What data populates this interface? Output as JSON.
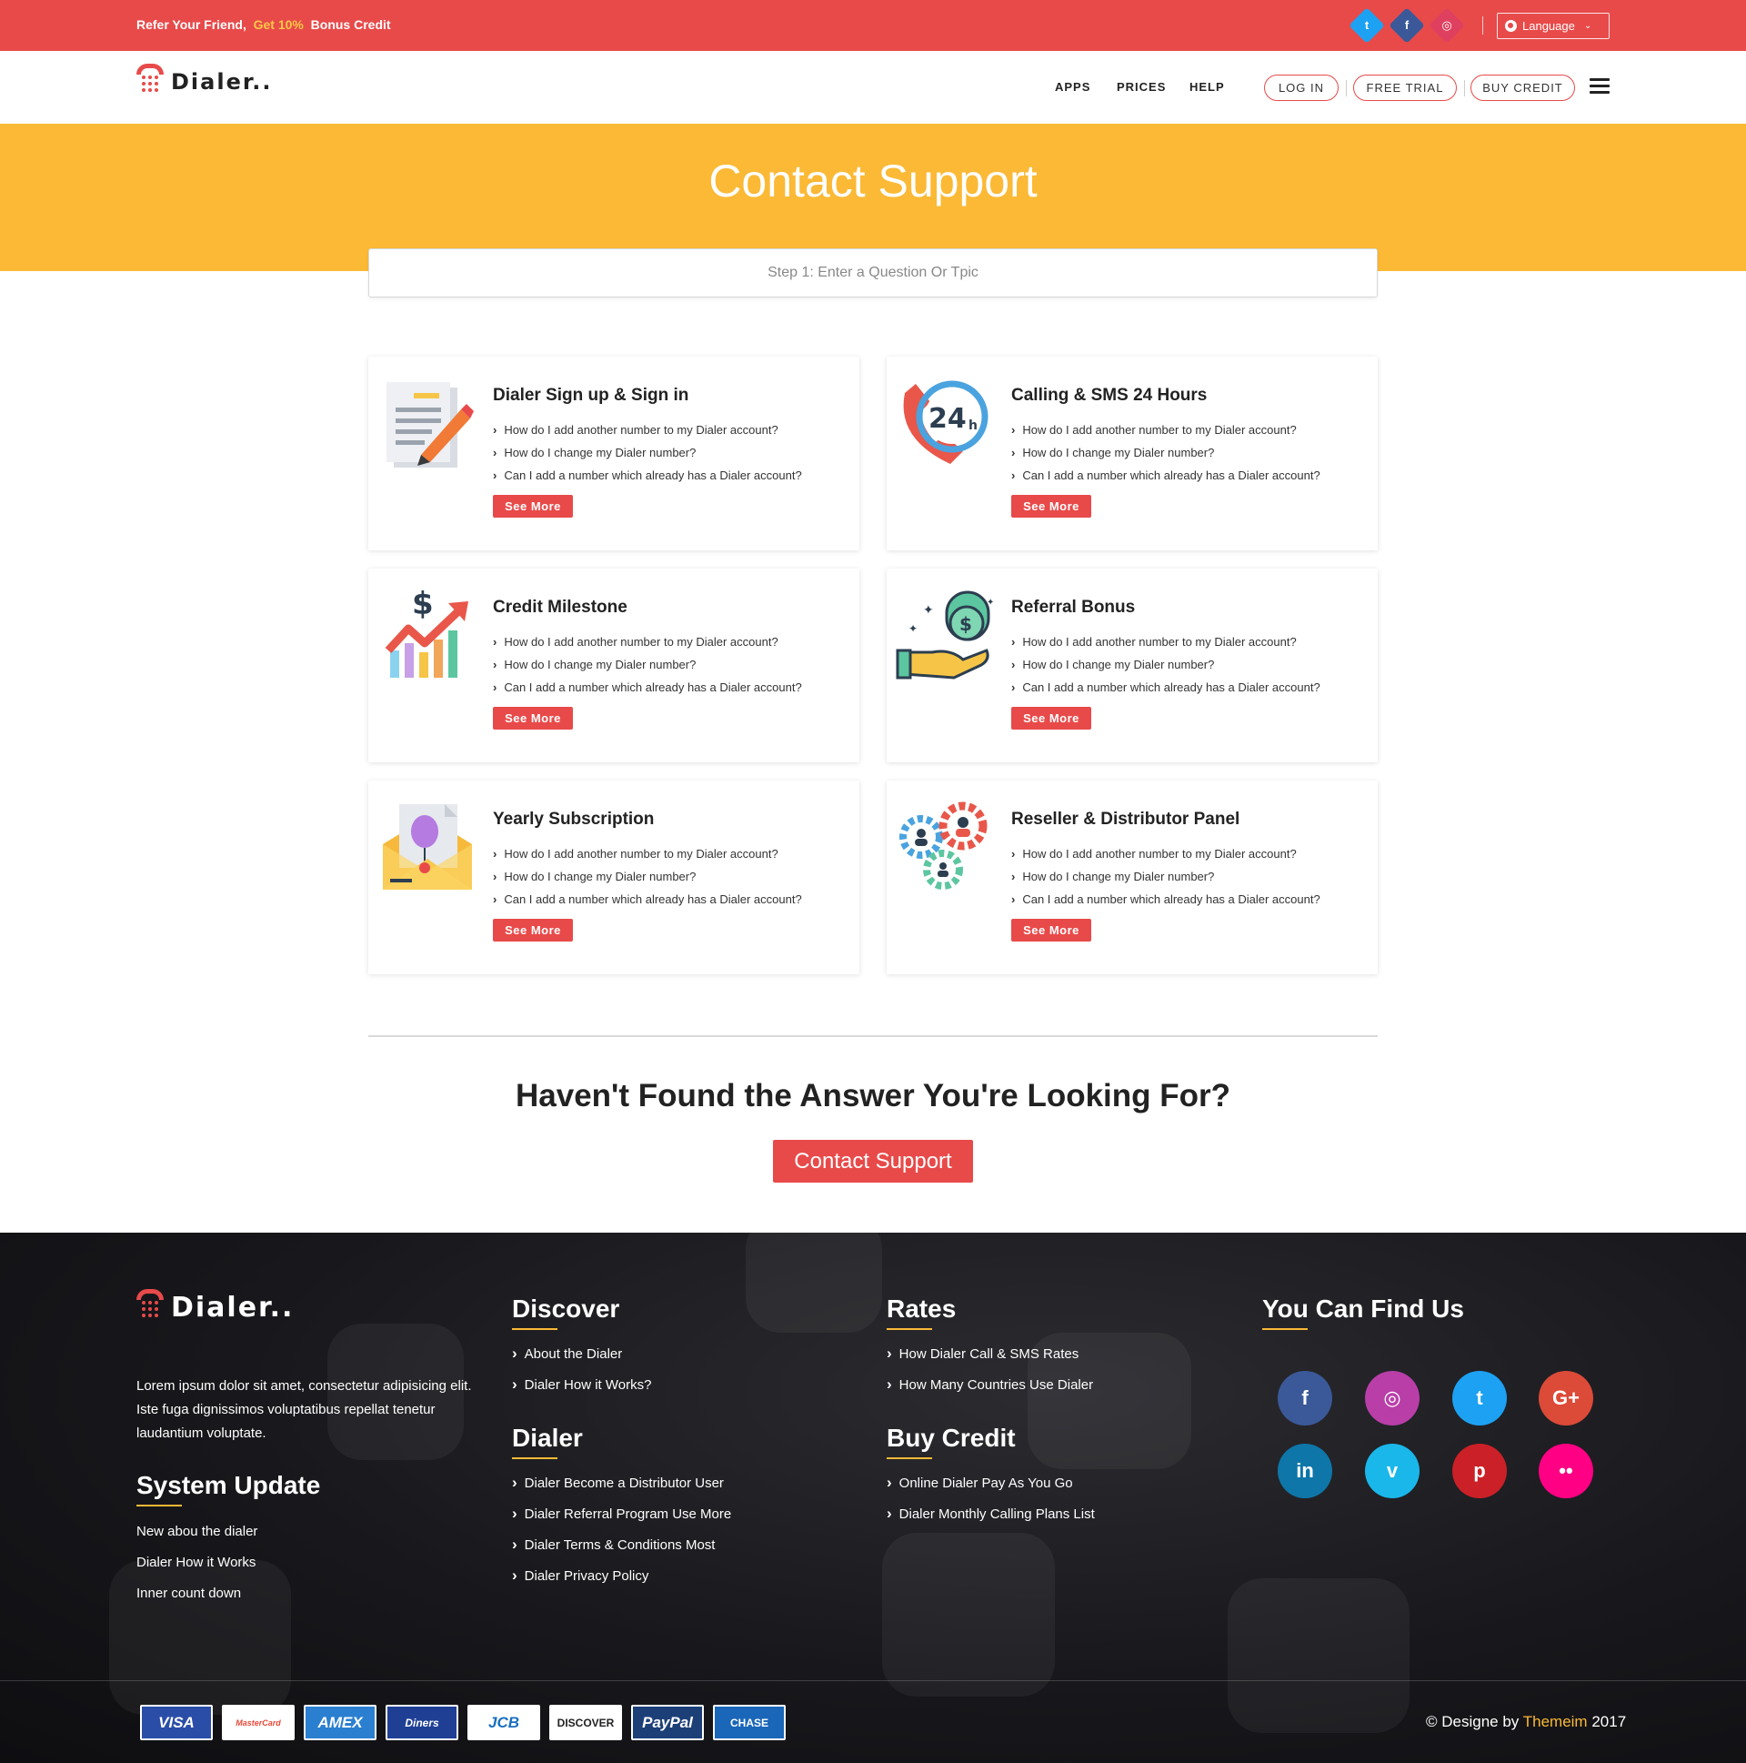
{
  "topbar": {
    "refer_prefix": "Refer Your Friend,",
    "refer_highlight": "Get 10%",
    "refer_suffix": "Bonus Credit",
    "language": "Language",
    "social": [
      {
        "icon": "twitter-icon",
        "glyph": "t",
        "color": "#1da1f2"
      },
      {
        "icon": "facebook-icon",
        "glyph": "f",
        "color": "#3b5998"
      },
      {
        "icon": "instagram-icon",
        "glyph": "◎",
        "color": "#e0405f"
      }
    ]
  },
  "nav": {
    "brand": "Dialer..",
    "menu": [
      "APPS",
      "PRICES",
      "HELP"
    ],
    "login": "LOG IN",
    "free_trial": "FREE TRIAL",
    "buy_credit": "BUY CREDIT"
  },
  "hero": {
    "title": "Contact Support",
    "search_placeholder": "Step 1: Enter a Question Or Tpic"
  },
  "cards": [
    {
      "title": "Dialer Sign up & Sign in",
      "icon": "document-pen-icon",
      "links": [
        "How do I add another number to my Dialer account?",
        "How do I change my Dialer number?",
        "Can I add a number which already has a Dialer account?"
      ],
      "button": "See More"
    },
    {
      "title": "Calling & SMS 24 Hours",
      "icon": "phone-24h-icon",
      "links": [
        "How do I add another number to my Dialer account?",
        "How do I change my Dialer number?",
        "Can I add a number which already has a Dialer account?"
      ],
      "button": "See More"
    },
    {
      "title": "Credit Milestone",
      "icon": "growth-chart-icon",
      "links": [
        "How do I add another number to my Dialer account?",
        "How do I change my Dialer number?",
        "Can I add a number which already has a Dialer account?"
      ],
      "button": "See More"
    },
    {
      "title": "Referral Bonus",
      "icon": "coins-hand-icon",
      "links": [
        "How do I add another number to my Dialer account?",
        "How do I change my Dialer number?",
        "Can I add a number which already has a Dialer account?"
      ],
      "button": "See More"
    },
    {
      "title": "Yearly Subscription",
      "icon": "envelope-balloon-icon",
      "links": [
        "How do I add another number to my Dialer account?",
        "How do I change my Dialer number?",
        "Can I add a number which already has a Dialer account?"
      ],
      "button": "See More"
    },
    {
      "title": "Reseller & Distributor Panel",
      "icon": "gears-people-icon",
      "links": [
        "How do I add another number to my Dialer account?",
        "How do I change my Dialer number?",
        "Can I add a number which already has a Dialer account?"
      ],
      "button": "See More"
    }
  ],
  "cta": {
    "heading": "Haven't Found the Answer You're Looking For?",
    "button": "Contact Support"
  },
  "footer": {
    "brand": "Dialer..",
    "about": "Lorem ipsum dolor sit amet, consectetur adipisicing elit. Iste fuga dignissimos voluptatibus repellat tenetur laudantium voluptate.",
    "system_update": {
      "title": "System Update",
      "items": [
        "New abou the dialer",
        "Dialer How it Works",
        "Inner count down"
      ]
    },
    "discover": {
      "title": "Discover",
      "items": [
        "About the Dialer",
        "Dialer How it Works?"
      ]
    },
    "dialer": {
      "title": "Dialer",
      "items": [
        "Dialer Become a Distributor User",
        "Dialer Referral Program Use More",
        "Dialer Terms & Conditions Most",
        "Dialer Privacy Policy"
      ]
    },
    "rates": {
      "title": "Rates",
      "items": [
        "How Dialer Call & SMS Rates",
        "How Many Countries Use Dialer"
      ]
    },
    "buy_credit": {
      "title": "Buy Credit",
      "items": [
        "Online Dialer Pay As You Go",
        "Dialer Monthly Calling Plans List"
      ]
    },
    "find_us": {
      "title": "You Can Find Us"
    },
    "social": [
      {
        "icon": "facebook-icon",
        "glyph": "f",
        "color": "#3b5998"
      },
      {
        "icon": "instagram-icon",
        "glyph": "◎",
        "color": "#b93ea8"
      },
      {
        "icon": "twitter-icon",
        "glyph": "t",
        "color": "#1da1f2"
      },
      {
        "icon": "google-plus-icon",
        "glyph": "G+",
        "color": "#dc4a38"
      },
      {
        "icon": "linkedin-icon",
        "glyph": "in",
        "color": "#0e76a8"
      },
      {
        "icon": "vimeo-icon",
        "glyph": "v",
        "color": "#1ab7ea"
      },
      {
        "icon": "pinterest-icon",
        "glyph": "p",
        "color": "#cb2027"
      },
      {
        "icon": "flickr-icon",
        "glyph": "••",
        "color": "#ff0084"
      }
    ],
    "payments": [
      {
        "label": "VISA",
        "bg": "#2a4da8",
        "fg": "#ffffff"
      },
      {
        "label": "MasterCard",
        "bg": "#ffffff",
        "fg": "#e84a3a"
      },
      {
        "label": "AMEX",
        "bg": "#2a7fd0",
        "fg": "#ffffff"
      },
      {
        "label": "Diners",
        "bg": "#1f3f95",
        "fg": "#ffffff"
      },
      {
        "label": "JCB",
        "bg": "#ffffff",
        "fg": "#1b6fbf"
      },
      {
        "label": "DISCOVER",
        "bg": "#ffffff",
        "fg": "#222222"
      },
      {
        "label": "PayPal",
        "bg": "#1d3f78",
        "fg": "#ffffff"
      },
      {
        "label": "CHASE",
        "bg": "#1a66b8",
        "fg": "#ffffff"
      }
    ],
    "copyright_prefix": "© Designe by",
    "copyright_brand": "Themeim",
    "copyright_year": "2017"
  }
}
